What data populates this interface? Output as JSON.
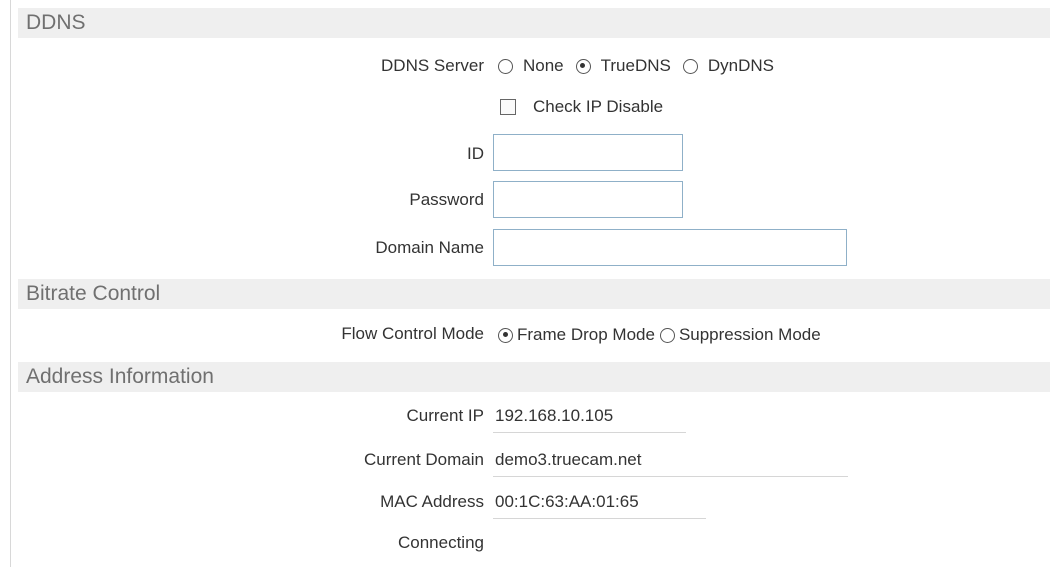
{
  "sections": {
    "ddns": {
      "title": "DDNS",
      "server_label": "DDNS Server",
      "server_options": [
        "None",
        "TrueDNS",
        "DynDNS"
      ],
      "server_selected": "TrueDNS",
      "check_ip_label": "Check IP Disable",
      "check_ip_checked": false,
      "id_label": "ID",
      "id_value": "",
      "password_label": "Password",
      "password_value": "",
      "domain_label": "Domain Name",
      "domain_value": ""
    },
    "bitrate": {
      "title": "Bitrate Control",
      "flow_label": "Flow Control Mode",
      "flow_options": [
        "Frame Drop Mode",
        "Suppression Mode"
      ],
      "flow_selected": "Frame Drop Mode"
    },
    "address": {
      "title": "Address Information",
      "current_ip_label": "Current IP",
      "current_ip_value": "192.168.10.105",
      "current_domain_label": "Current Domain",
      "current_domain_value": "demo3.truecam.net",
      "mac_label": "MAC Address",
      "mac_value": "00:1C:63:AA:01:65",
      "connecting_label": "Connecting"
    }
  },
  "colors": {
    "header_bg": "#efefef",
    "header_text": "#707070",
    "input_border": "#8fb0c8"
  }
}
